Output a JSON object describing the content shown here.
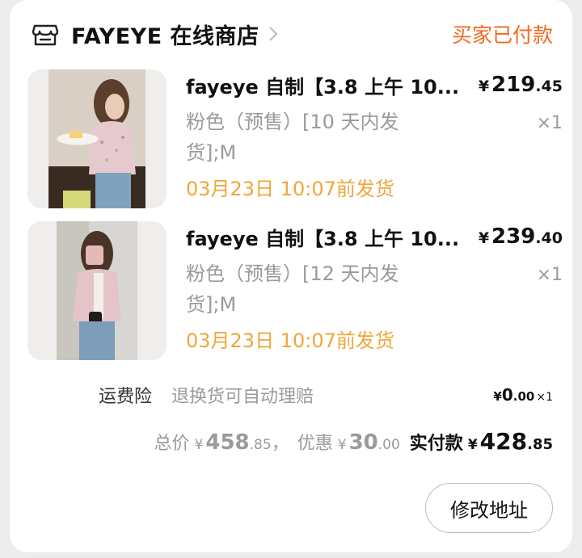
{
  "shop": {
    "name": "FAYEYE 在线商店",
    "status": "买家已付款"
  },
  "items": [
    {
      "title": "fayeye 自制【3.8 上午 10...",
      "price_symbol": "¥",
      "price_int": "219",
      "price_dec": ".45",
      "spec": "粉色（预售）[10 天内发货];M",
      "qty": "×1",
      "ship_by": "03月23日 10:07前发货"
    },
    {
      "title": "fayeye 自制【3.8 上午 10...",
      "price_symbol": "¥",
      "price_int": "239",
      "price_dec": ".40",
      "spec": "粉色（预售）[12 天内发货];M",
      "qty": "×1",
      "ship_by": "03月23日 10:07前发货"
    }
  ],
  "insurance": {
    "label": "运费险",
    "desc": "退换货可自动理赔",
    "price_symbol": "¥",
    "price_int": "0",
    "price_dec": ".00",
    "qty": "×1"
  },
  "totals": {
    "total_label": "总价",
    "total_symbol": "¥",
    "total_int": "458",
    "total_dec": ".85",
    "separator": "，",
    "discount_label": "优惠",
    "discount_symbol": "¥",
    "discount_int": "30",
    "discount_dec": ".00",
    "paid_label": "实付款",
    "paid_symbol": "¥",
    "paid_int": "428",
    "paid_dec": ".85"
  },
  "actions": {
    "modify_address": "修改地址"
  },
  "colors": {
    "status": "#f26a21",
    "ship_by": "#f0a63b",
    "muted": "#9a9a9a"
  },
  "icons": {
    "shop": "store-icon",
    "chevron": "chevron-right-icon"
  }
}
